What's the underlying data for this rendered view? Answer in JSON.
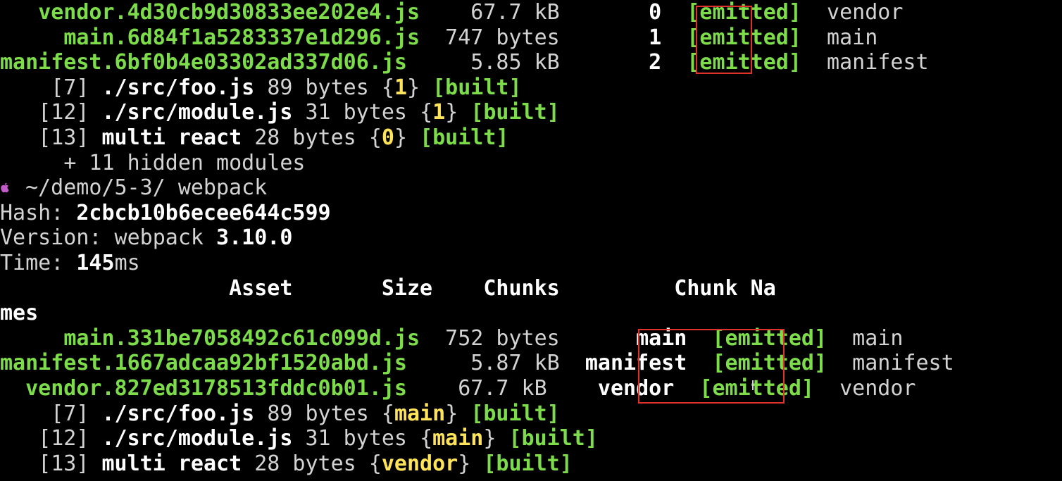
{
  "build1": {
    "assets": [
      {
        "name": "vendor.4d30cb9d30833ee202e4.js",
        "size": "67.7 kB",
        "chunk": "0",
        "status": "[emitted]",
        "chunk_name": "vendor"
      },
      {
        "name": "main.6d84f1a5283337e1d296.js",
        "size": "747 bytes",
        "chunk": "1",
        "status": "[emitted]",
        "chunk_name": "main"
      },
      {
        "name": "manifest.6bf0b4e03302ad337d06.js",
        "size": "5.85 kB",
        "chunk": "2",
        "status": "[emitted]",
        "chunk_name": "manifest"
      }
    ],
    "modules": [
      {
        "id": "[7]",
        "path": "./src/foo.js",
        "size": "89 bytes",
        "chunk": "1",
        "status": "[built]"
      },
      {
        "id": "[12]",
        "path": "./src/module.js",
        "size": "31 bytes",
        "chunk": "1",
        "status": "[built]"
      },
      {
        "id": "[13]",
        "path": "multi react",
        "size": "28 bytes",
        "chunk": "0",
        "status": "[built]"
      }
    ],
    "hidden_modules": "+ 11 hidden modules"
  },
  "prompt": {
    "icon": "apple-icon",
    "path": "~/demo/5-3/",
    "command": "webpack"
  },
  "build2": {
    "hash_label": "Hash:",
    "hash_value": "2cbcb10b6ecee644c599",
    "version_label": "Version: webpack",
    "version_value": "3.10.0",
    "time_label": "Time:",
    "time_value": "145",
    "time_unit": "ms",
    "headers": {
      "asset": "Asset",
      "size": "Size",
      "chunks": "Chunks",
      "chunk_names_1": "Chunk Na",
      "chunk_names_2": "mes"
    },
    "assets": [
      {
        "name": "main.331be7058492c61c099d.js",
        "size": "752 bytes",
        "chunk": "main",
        "status": "[emitted]",
        "chunk_name": "main"
      },
      {
        "name": "manifest.1667adcaa92bf1520abd.js",
        "size": "5.87 kB",
        "chunk": "manifest",
        "status": "[emitted]",
        "chunk_name": "manifest"
      },
      {
        "name": "vendor.827ed3178513fddc0b01.js",
        "size": "67.7 kB",
        "chunk": "vendor",
        "status": "[emitted]",
        "chunk_name": "vendor"
      }
    ],
    "modules": [
      {
        "id": "[7]",
        "path": "./src/foo.js",
        "size": "89 bytes",
        "chunk": "main",
        "status": "[built]"
      },
      {
        "id": "[12]",
        "path": "./src/module.js",
        "size": "31 bytes",
        "chunk": "main",
        "status": "[built]"
      },
      {
        "id": "[13]",
        "path": "multi react",
        "size": "28 bytes",
        "chunk": "vendor",
        "status": "[built]"
      }
    ]
  },
  "colors": {
    "background": "#000000",
    "text": "#d3d3d3",
    "asset_green": "#7ddc4a",
    "chunk_yellow": "#ffe45a",
    "highlight_red": "#e0322b",
    "prompt_magenta": "#c45acb"
  }
}
